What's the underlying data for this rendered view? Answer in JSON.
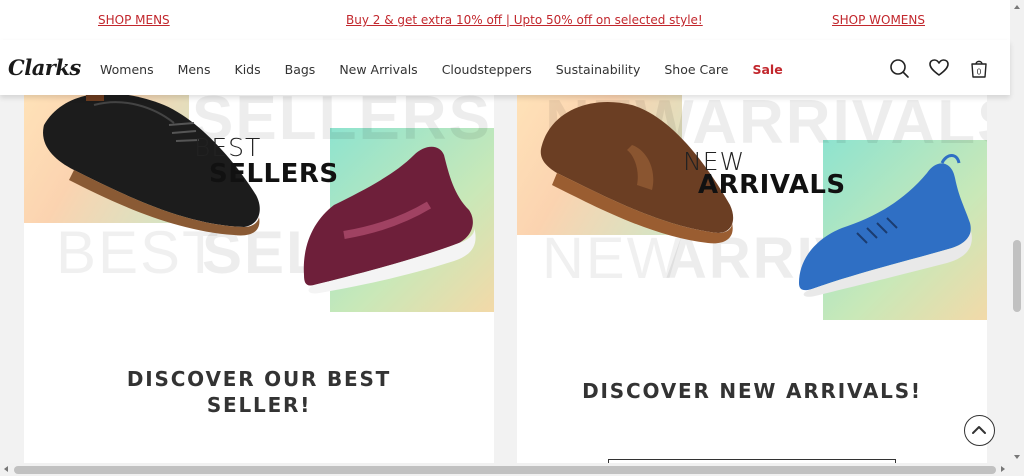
{
  "promo": {
    "left_link": "SHOP MENS",
    "center_text": "Buy 2 & get extra 10% off  |  Upto 50% off on selected style!",
    "right_link": "SHOP WOMENS "
  },
  "header": {
    "logo": "Clarks",
    "nav": [
      "Womens",
      "Mens",
      "Kids",
      "Bags",
      "New Arrivals",
      "Cloudsteppers",
      "Sustainability",
      "Shoe Care",
      "Sale"
    ],
    "bag_count": "0"
  },
  "cards": {
    "left": {
      "banner_small": "BEST",
      "banner_big": "SELLERS",
      "ghost_top": "SELLERS",
      "ghost_bottom_thin": "BEST",
      "ghost_bottom_bold": "SELL",
      "title_line1": "DISCOVER OUR BEST",
      "title_line2": "SELLER!"
    },
    "right": {
      "banner_small": "NEW",
      "banner_big": "ARRIVALS",
      "ghost_top": "NEWARRIVALS",
      "ghost_bottom_thin": "NEW",
      "ghost_bottom_bold": "ARRIV",
      "title": "DISCOVER NEW ARRIVALS!"
    }
  },
  "colors": {
    "brand_red": "#c2272d",
    "text_dark": "#333333"
  }
}
